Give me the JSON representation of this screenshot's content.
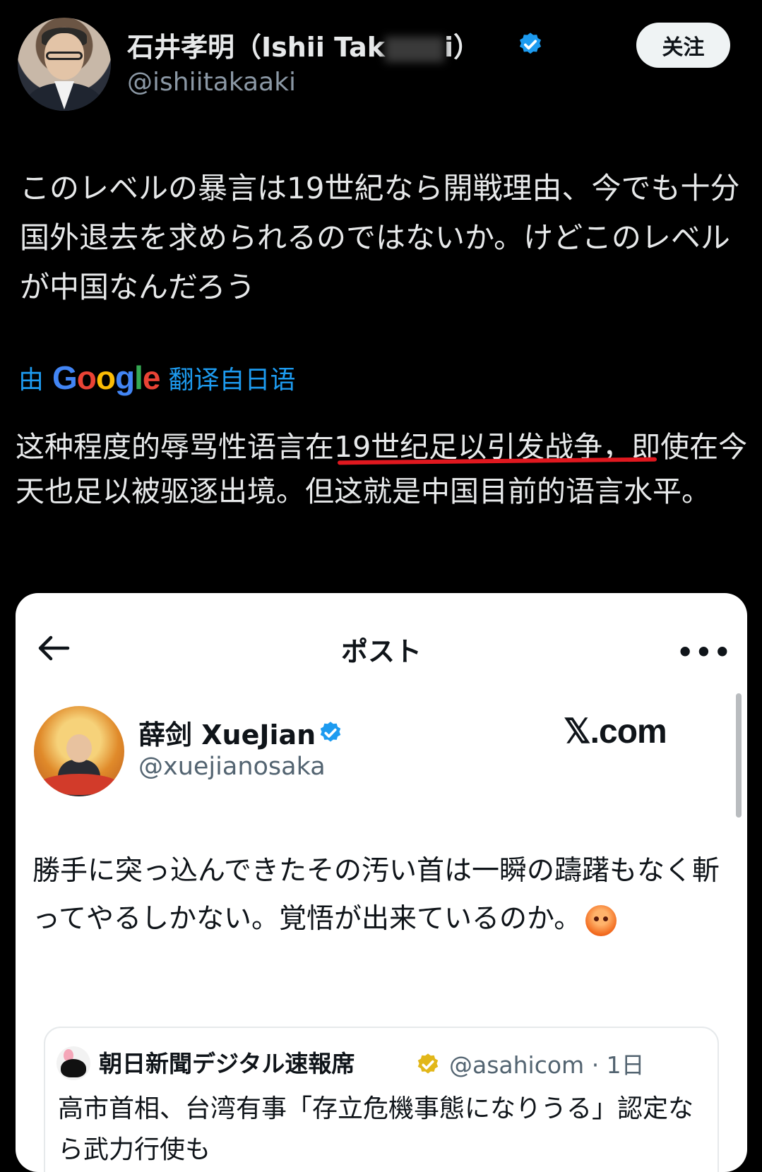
{
  "post": {
    "author_name": "石井孝明（Ishii Tak",
    "author_name_tail": "i）",
    "author_handle": "@ishiitakaaki",
    "follow_label": "关注",
    "original_text": "このレベルの暴言は19世紀なら開戦理由、今でも十分国外退去を求められるのではないか。けどこのレベルが中国なんだろう",
    "translate_prefix": "由",
    "translate_brand": "Google",
    "translate_suffix": "翻译自日语",
    "translated_text": "这种程度的辱骂性语言在19世纪足以引发战争，即使在今天也足以被驱逐出境。但这就是中国目前的语言水平。"
  },
  "embedded": {
    "title": "ポスト",
    "more_label": "•••",
    "author_name": "薛剑 XueJian",
    "author_handle": "@xuejianosaka",
    "site_logo": "𝕏.com",
    "post_text": "勝手に突っ込んできたその汚い首は一瞬の躊躇もなく斬ってやるしかない。覚悟が出来ているのか。",
    "emoji": "angry-face",
    "quote": {
      "author_name": "朝日新聞デジタル速報席",
      "author_handle": "@asahicom · 1日",
      "text": "高市首相、台湾有事「存立危機事態になりうる」認定なら武力行使も"
    }
  },
  "colors": {
    "background": "#000000",
    "link_blue": "#1d9bf0",
    "verified_blue": "#1d9bf0",
    "underline_red": "#e0181f",
    "gold_badge": "#e2b719"
  }
}
